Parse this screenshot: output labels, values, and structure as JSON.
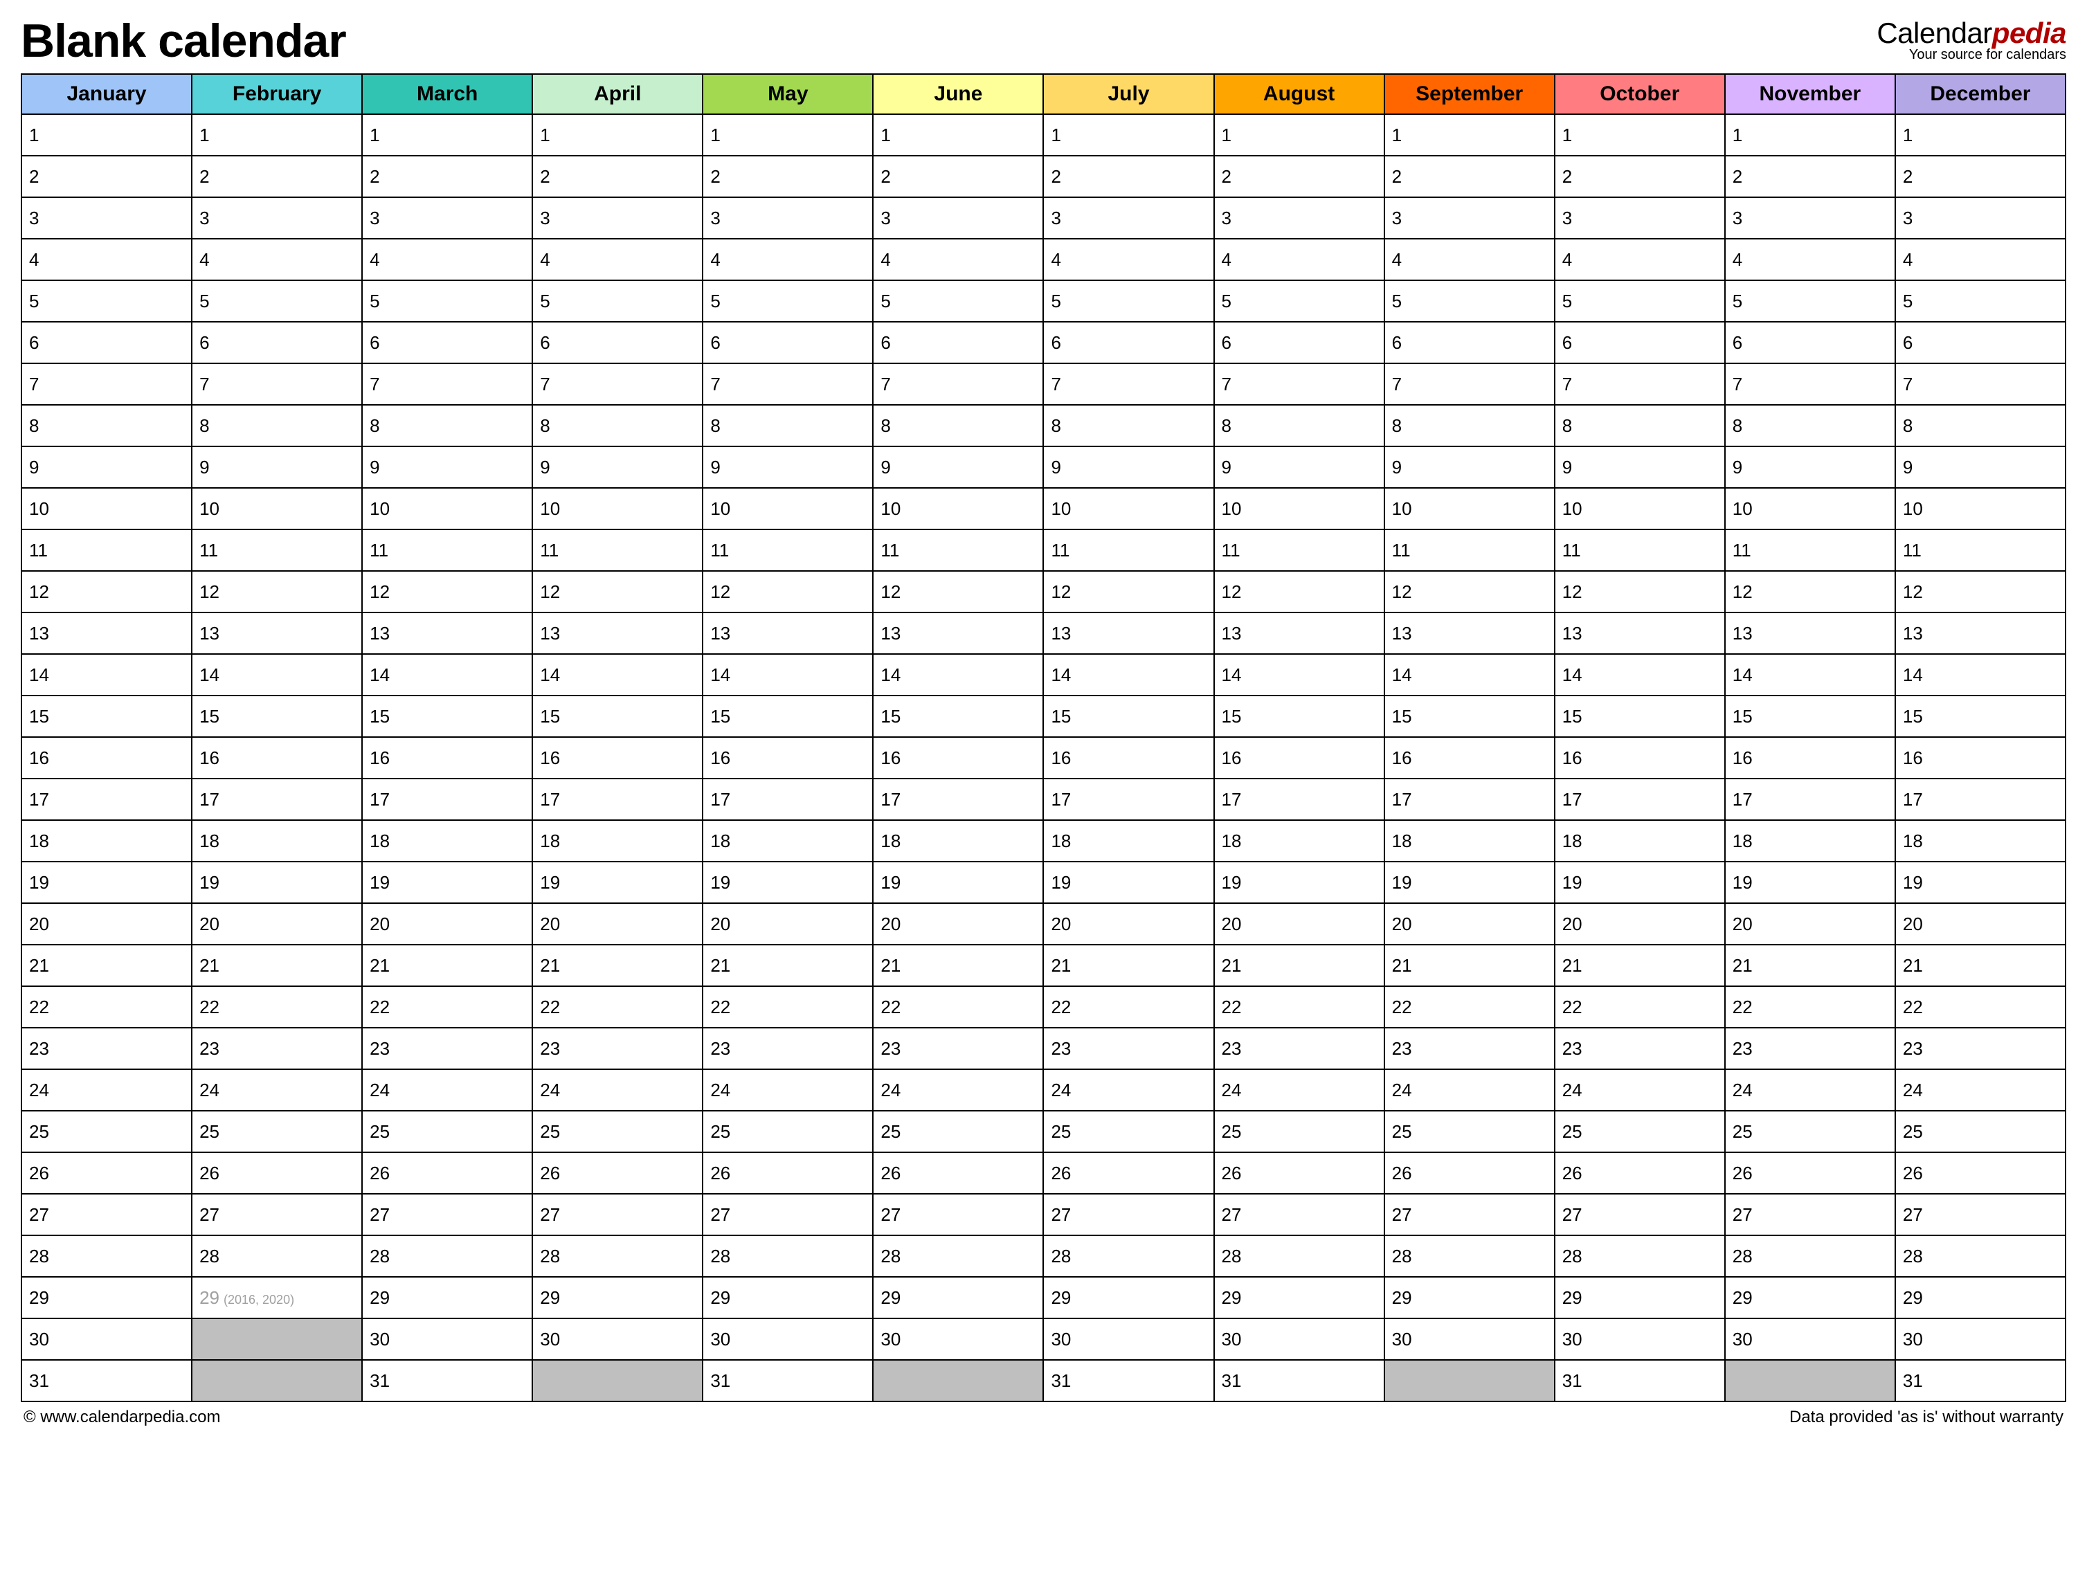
{
  "title": "Blank calendar",
  "brand": {
    "prefix": "Calendar",
    "suffix": "pedia",
    "tagline": "Your source for calendars"
  },
  "months": [
    {
      "name": "January",
      "color": "#9fc5f8",
      "days": 31
    },
    {
      "name": "February",
      "color": "#56d2d8",
      "days": 28,
      "leap_day": 29,
      "leap_years": "(2016, 2020)",
      "pad_after_leap": 2
    },
    {
      "name": "March",
      "color": "#32c4b2",
      "days": 31
    },
    {
      "name": "April",
      "color": "#c6efce",
      "days": 30
    },
    {
      "name": "May",
      "color": "#a2d951",
      "days": 31
    },
    {
      "name": "June",
      "color": "#ffff99",
      "days": 30
    },
    {
      "name": "July",
      "color": "#ffd966",
      "days": 31
    },
    {
      "name": "August",
      "color": "#ffa500",
      "days": 31
    },
    {
      "name": "September",
      "color": "#ff6600",
      "days": 30
    },
    {
      "name": "October",
      "color": "#ff7c80",
      "days": 31
    },
    {
      "name": "November",
      "color": "#d9b3ff",
      "days": 30
    },
    {
      "name": "December",
      "color": "#b4a7e6",
      "days": 31
    }
  ],
  "max_rows": 31,
  "footer": {
    "left": "© www.calendarpedia.com",
    "right": "Data provided 'as is' without warranty"
  }
}
